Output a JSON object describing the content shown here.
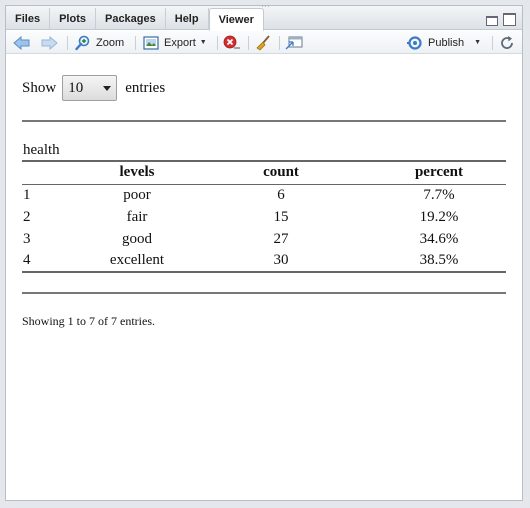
{
  "tabs": [
    {
      "label": "Files"
    },
    {
      "label": "Plots"
    },
    {
      "label": "Packages"
    },
    {
      "label": "Help"
    },
    {
      "label": "Viewer",
      "active": true
    }
  ],
  "toolbar": {
    "zoom_label": "Zoom",
    "export_label": "Export",
    "publish_label": "Publish"
  },
  "length_menu": {
    "prefix": "Show",
    "selected": "10",
    "suffix": "entries"
  },
  "table": {
    "caption": "health",
    "headers": [
      "",
      "levels",
      "count",
      "percent"
    ],
    "rows": [
      [
        "1",
        "poor",
        "6",
        "7.7%"
      ],
      [
        "2",
        "fair",
        "15",
        "19.2%"
      ],
      [
        "3",
        "good",
        "27",
        "34.6%"
      ],
      [
        "4",
        "excellent",
        "30",
        "38.5%"
      ]
    ]
  },
  "info_text": "Showing 1 to 7 of 7 entries.",
  "colors": {
    "accent_blue": "#3a7bc8",
    "stop_red": "#d32f2f",
    "broom_yellow": "#d8a520"
  }
}
